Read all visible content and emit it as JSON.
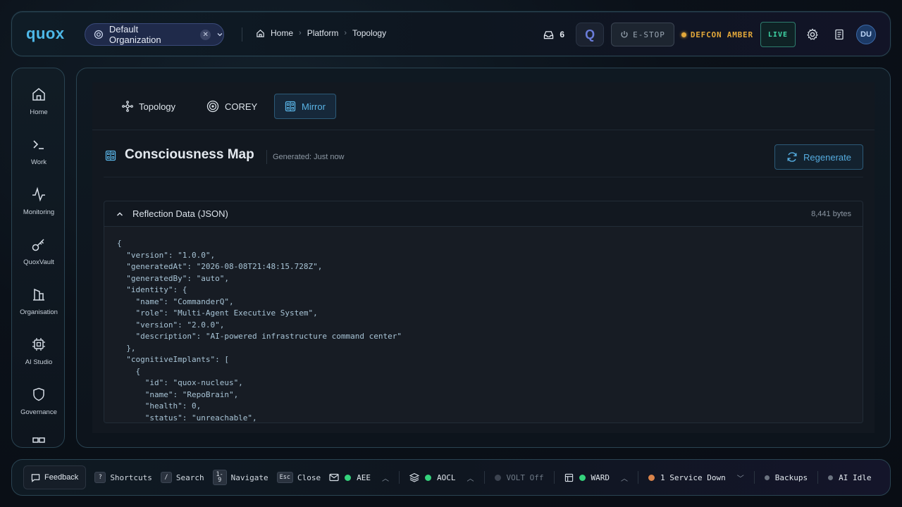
{
  "brand": {
    "logo": "quox"
  },
  "org": {
    "name": "Default Organization"
  },
  "breadcrumb": {
    "home": "Home",
    "platform": "Platform",
    "current": "Topology"
  },
  "topbar": {
    "inbox_count": "6",
    "q_label": "Q",
    "estop_label": "E-STOP",
    "defcon_label": "DEFCON AMBER",
    "live_label": "LIVE",
    "avatar_initials": "DU",
    "defcon_color": "#e3a83a",
    "live_color": "#3fd6a6"
  },
  "sidebar": {
    "items": [
      {
        "label": "Home",
        "icon": "home-icon"
      },
      {
        "label": "Work",
        "icon": "terminal-icon"
      },
      {
        "label": "Monitoring",
        "icon": "activity-icon"
      },
      {
        "label": "QuoxVault",
        "icon": "key-icon"
      },
      {
        "label": "Organisation",
        "icon": "building-icon"
      },
      {
        "label": "AI Studio",
        "icon": "cpu-icon"
      },
      {
        "label": "Governance",
        "icon": "shield-icon"
      }
    ]
  },
  "tabs": [
    {
      "label": "Topology",
      "icon": "topology-icon"
    },
    {
      "label": "COREY",
      "icon": "target-icon"
    },
    {
      "label": "Mirror",
      "icon": "mirror-icon",
      "active": true
    }
  ],
  "page": {
    "title": "Consciousness Map",
    "generated": "Generated: Just now",
    "regenerate_label": "Regenerate"
  },
  "json_panel": {
    "title": "Reflection Data (JSON)",
    "size": "8,441 bytes",
    "lines": [
      "{",
      "  \"version\": \"1.0.0\",",
      "  \"generatedAt\": \"2026-08-08T21:48:15.728Z\",",
      "  \"generatedBy\": \"auto\",",
      "  \"identity\": {",
      "    \"name\": \"CommanderQ\",",
      "    \"role\": \"Multi-Agent Executive System\",",
      "    \"version\": \"2.0.0\",",
      "    \"description\": \"AI-powered infrastructure command center\"",
      "  },",
      "  \"cognitiveImplants\": [",
      "    {",
      "      \"id\": \"quox-nucleus\",",
      "      \"name\": \"RepoBrain\",",
      "      \"health\": 0,",
      "      \"status\": \"unreachable\","
    ]
  },
  "bottombar": {
    "feedback_label": "Feedback",
    "shortcuts": [
      {
        "key": "?",
        "label": "Shortcuts"
      },
      {
        "key": "/",
        "label": "Search"
      },
      {
        "key": "1-9",
        "label": "Navigate"
      },
      {
        "key": "Esc",
        "label": "Close"
      }
    ],
    "statuses": {
      "aee": "AEE",
      "aocl": "AOCL",
      "volt": "VOLT Off",
      "ward": "WARD",
      "service": "1 Service Down",
      "backups": "Backups",
      "ai": "AI Idle"
    },
    "colors": {
      "ok": "#34d37c",
      "off": "#3c4350",
      "warn": "#d9834a",
      "idle": "#6b7380"
    }
  }
}
